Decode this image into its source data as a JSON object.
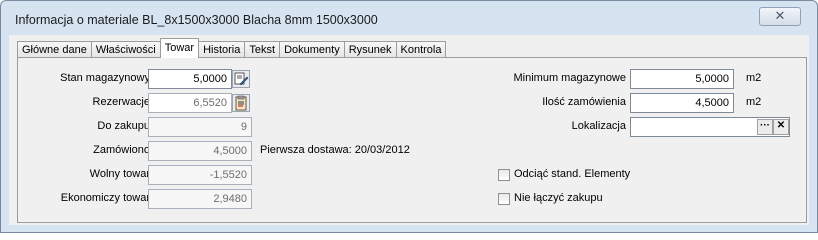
{
  "window": {
    "title": "Informacja o materiale BL_8x1500x3000 Blacha 8mm 1500x3000",
    "close_symbol": "✕"
  },
  "tabs": [
    {
      "label": "Główne dane"
    },
    {
      "label": "Właściwości"
    },
    {
      "label": "Towar",
      "active": true
    },
    {
      "label": "Historia"
    },
    {
      "label": "Tekst"
    },
    {
      "label": "Dokumenty"
    },
    {
      "label": "Rysunek"
    },
    {
      "label": "Kontrola"
    }
  ],
  "left": {
    "stan_magazynowy": {
      "label": "Stan magazynowy",
      "value": "5,0000"
    },
    "rezerwacje": {
      "label": "Rezerwacje",
      "value": "6,5520"
    },
    "do_zakupu": {
      "label": "Do zakupu",
      "value": "9"
    },
    "zamowiono": {
      "label": "Zamówiono",
      "value": "4,5000"
    },
    "wolny_towar": {
      "label": "Wolny towar",
      "value": "-1,5520"
    },
    "ekonomiczny_towar": {
      "label": "Ekonomiczy towar",
      "value": "2,9480"
    },
    "pierwsza_dostawa": "Pierwsza dostawa: 20/03/2012"
  },
  "right": {
    "minimum": {
      "label": "Minimum magazynowe",
      "value": "5,0000",
      "unit": "m2"
    },
    "ilosc": {
      "label": "Ilość zamówienia",
      "value": "4,5000",
      "unit": "m2"
    },
    "lokalizacja": {
      "label": "Lokalizacja",
      "value": "",
      "browse": "···",
      "clear": "✕"
    },
    "odciac": {
      "label": "Odciąć stand. Elementy",
      "checked": false
    },
    "nie_laczyc": {
      "label": "Nie łączyć zakupu",
      "checked": false
    }
  }
}
